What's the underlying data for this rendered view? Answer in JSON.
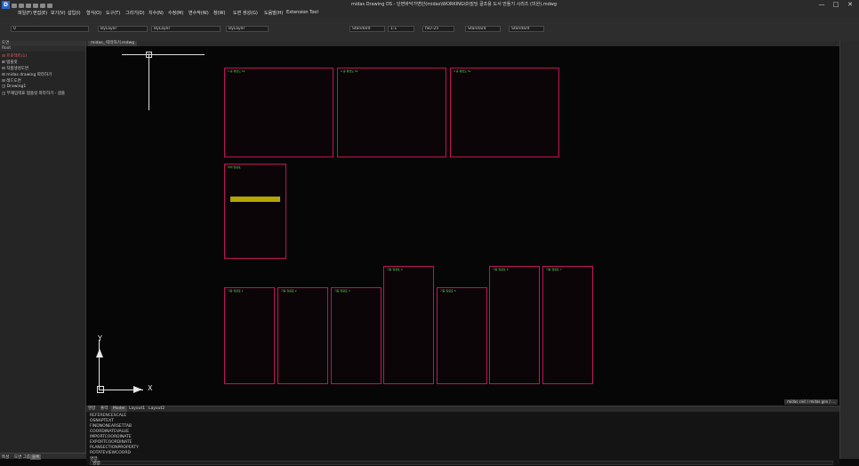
{
  "titlebar": {
    "logo": "D",
    "title": "midas Drawing DS - 단면바닥가변단(midas\\WORKING\\0\\빌딩 골조용 도서 만들기 시리즈 (미완).mdwg",
    "win_minimize": "—",
    "win_maximize": "□",
    "win_close": "✕"
  },
  "menu": [
    "파일(F)",
    "편집(E)",
    "보기(V)",
    "삽입(I)",
    "형식(O)",
    "도구(T)",
    "그리기(D)",
    "치수(N)",
    "수정(M)",
    "변수작(W)",
    "창(W)",
    "도면 생성(G)",
    "도움말(H)",
    "Extension Tool"
  ],
  "toolbar2": {
    "layer": "0",
    "color": "ByLayer",
    "linetype": "ByLayer",
    "lineweight": "ByLayer",
    "text_style": "Standard",
    "scale": "1:1",
    "dim_style": "ISO-25",
    "table_style": "Standard",
    "multileader": "Standard"
  },
  "sidebar": {
    "header": "도면",
    "subheader": "Root",
    "items": [
      "⊟ 프로젝트(1)",
      "  ⊞ 템플릿",
      "  ⊟ 작품생성도면",
      "  ⊟ midas drawing 따라하기",
      "  ⊟ 레드도면",
      "    ◫ Drawing1",
      "    ◫ 부재입력표 템플릿 따라하기 - 샘플"
    ],
    "bottom_tabs": [
      "특성",
      "도면 그룹",
      "블록"
    ]
  },
  "canvas_tab": "midas_ 따라하기.mdwg",
  "ucs": {
    "x_label": "X",
    "y_label": "Y"
  },
  "sheets": [
    {
      "title": "1 층 평면도 S1"
    },
    {
      "title": "2 층 평면도 S1"
    },
    {
      "title": "3 층 평면도 S1"
    },
    {
      "title": "부재 일람표"
    },
    {
      "title": "기둥 일람표 1"
    },
    {
      "title": "기둥 일람표 2"
    },
    {
      "title": "기둥 일람표 3"
    },
    {
      "title": "기둥 일람표 4"
    },
    {
      "title": "기둥 일람표 5"
    },
    {
      "title": "기둥 일람표 6"
    },
    {
      "title": "기둥 일람표 7"
    }
  ],
  "cmd": {
    "tabs": [
      "명령",
      "출력",
      "Model",
      "Layout1",
      "Layout2"
    ],
    "lines": [
      "REFERENCESCALE",
      "OSNAPTEXT",
      "FINDNONEARSETTAB",
      "COORDINATEVALUE",
      "IMPORTCOORDINATE",
      "EXPORTCOORDINATE",
      "PLANSECTIONPROPERTY",
      "ROTATEVIEWCOORD",
      "명령:"
    ],
    "input_label": "명령:",
    "status_right": "midas civil / midas gen / ..."
  }
}
